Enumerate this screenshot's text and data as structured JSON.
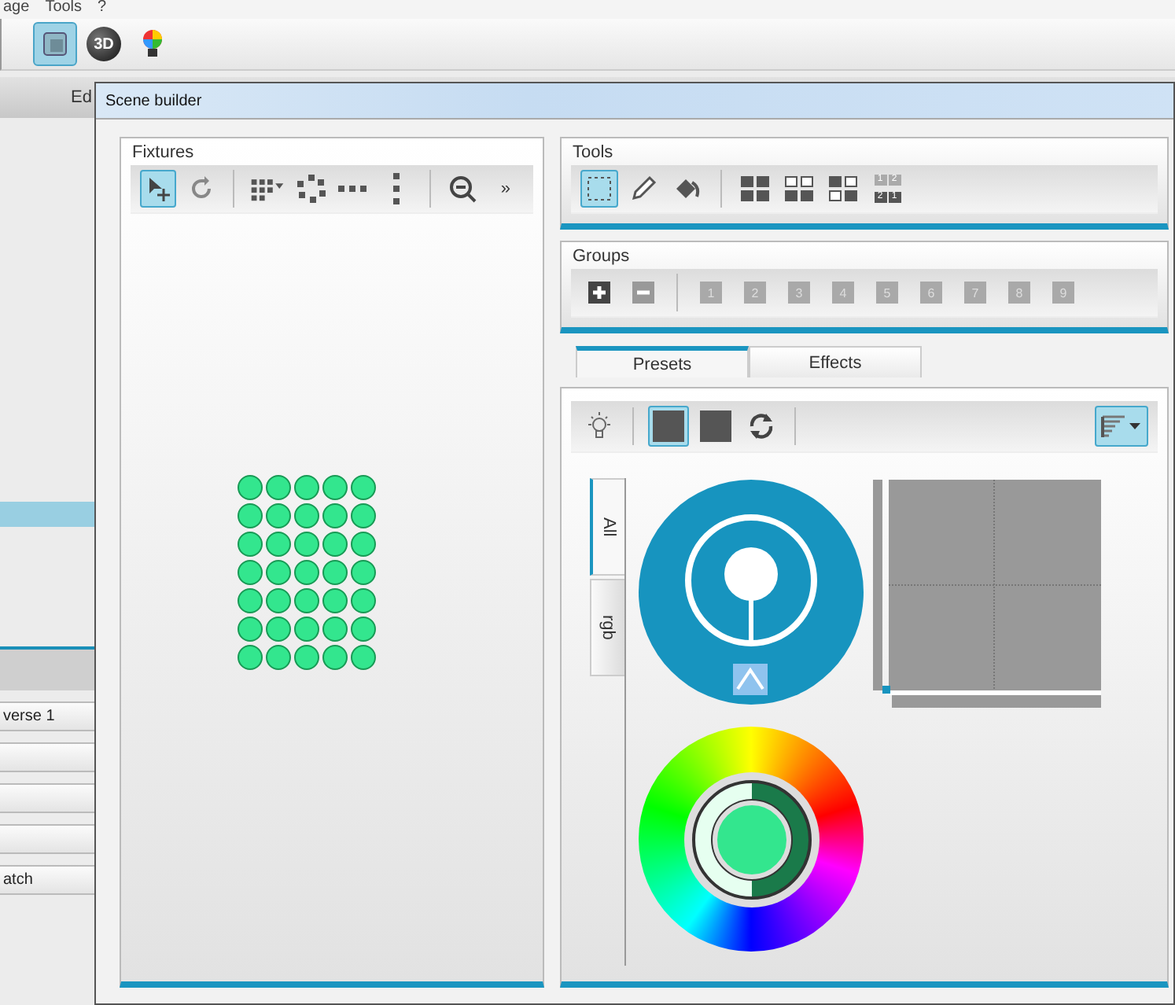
{
  "app": {
    "menu": [
      "age",
      "Tools",
      "?"
    ],
    "toolbar": [
      {
        "kind": "view2d",
        "selected": true
      },
      {
        "kind": "view3d",
        "label": "3D",
        "selected": false
      },
      {
        "kind": "bulb",
        "selected": false
      }
    ],
    "tab_label": "Ed",
    "rows": [
      {
        "kind": "highlight"
      },
      {
        "kind": "band"
      },
      {
        "kind": "row",
        "text": "verse 1"
      },
      {
        "kind": "row"
      },
      {
        "kind": "row"
      },
      {
        "kind": "row"
      },
      {
        "kind": "row",
        "text": "atch"
      }
    ]
  },
  "dialog": {
    "title": "Scene builder",
    "fixtures": {
      "title": "Fixtures",
      "tools": [
        {
          "kind": "select",
          "selected": true
        },
        {
          "kind": "rotate",
          "selected": false
        },
        {
          "kind": "sep"
        },
        {
          "kind": "grid",
          "selected": false
        },
        {
          "kind": "ring",
          "selected": false
        },
        {
          "kind": "hline",
          "selected": false
        },
        {
          "kind": "vline",
          "selected": false
        },
        {
          "kind": "sep"
        },
        {
          "kind": "zoom-out",
          "selected": false
        },
        {
          "kind": "more",
          "label": "»",
          "selected": false
        }
      ],
      "grid": [
        [
          {
            "color": "#33e68e"
          },
          {
            "color": "#33e68e"
          },
          {
            "color": "#33e68e"
          },
          {
            "color": "#33e68e"
          },
          {
            "color": "#33e68e"
          }
        ],
        [
          {
            "color": "#33e68e"
          },
          {
            "color": "#33e68e"
          },
          {
            "color": "#33e68e"
          },
          {
            "color": "#33e68e"
          },
          {
            "color": "#33e68e"
          }
        ],
        [
          {
            "color": "#33e68e"
          },
          {
            "color": "#33e68e"
          },
          {
            "color": "#33e68e"
          },
          {
            "color": "#33e68e"
          },
          {
            "color": "#33e68e"
          }
        ],
        [
          {
            "color": "#33e68e"
          },
          {
            "color": "#33e68e"
          },
          {
            "color": "#33e68e"
          },
          {
            "color": "#33e68e"
          },
          {
            "color": "#33e68e"
          }
        ],
        [
          {
            "color": "#33e68e"
          },
          {
            "color": "#33e68e"
          },
          {
            "color": "#33e68e"
          },
          {
            "color": "#33e68e"
          },
          {
            "color": "#33e68e"
          }
        ],
        [
          {
            "color": "#33e68e"
          },
          {
            "color": "#33e68e"
          },
          {
            "color": "#33e68e"
          },
          {
            "color": "#33e68e"
          },
          {
            "color": "#33e68e"
          }
        ],
        [
          {
            "color": "#33e68e"
          },
          {
            "color": "#33e68e"
          },
          {
            "color": "#33e68e"
          },
          {
            "color": "#33e68e"
          },
          {
            "color": "#33e68e"
          }
        ]
      ]
    },
    "tools": {
      "title": "Tools",
      "buttons": [
        {
          "kind": "rect-select",
          "selected": true
        },
        {
          "kind": "pencil",
          "selected": false
        },
        {
          "kind": "bucket",
          "selected": false
        },
        {
          "kind": "sep"
        },
        {
          "kind": "fill-all",
          "selected": false
        },
        {
          "kind": "fill-bottom",
          "selected": false
        },
        {
          "kind": "fill-diagonal",
          "selected": false
        },
        {
          "kind": "numbers",
          "labels": [
            "1",
            "2",
            "2",
            "1"
          ],
          "selected": false
        }
      ]
    },
    "groups": {
      "title": "Groups",
      "numbers": [
        "1",
        "2",
        "3",
        "4",
        "5",
        "6",
        "7",
        "8",
        "9"
      ]
    },
    "tabs": [
      {
        "label": "Presets",
        "selected": true
      },
      {
        "label": "Effects",
        "selected": false
      }
    ],
    "preset_tools": [
      {
        "kind": "bulb",
        "selected": false
      },
      {
        "kind": "sep"
      },
      {
        "kind": "square",
        "selected": true
      },
      {
        "kind": "square",
        "selected": false
      },
      {
        "kind": "refresh",
        "selected": false
      },
      {
        "kind": "sep"
      }
    ],
    "sort_button": {
      "selected": true
    },
    "side_tabs": [
      {
        "label": "All",
        "selected": true
      },
      {
        "label": "rgb",
        "selected": false
      }
    ]
  }
}
